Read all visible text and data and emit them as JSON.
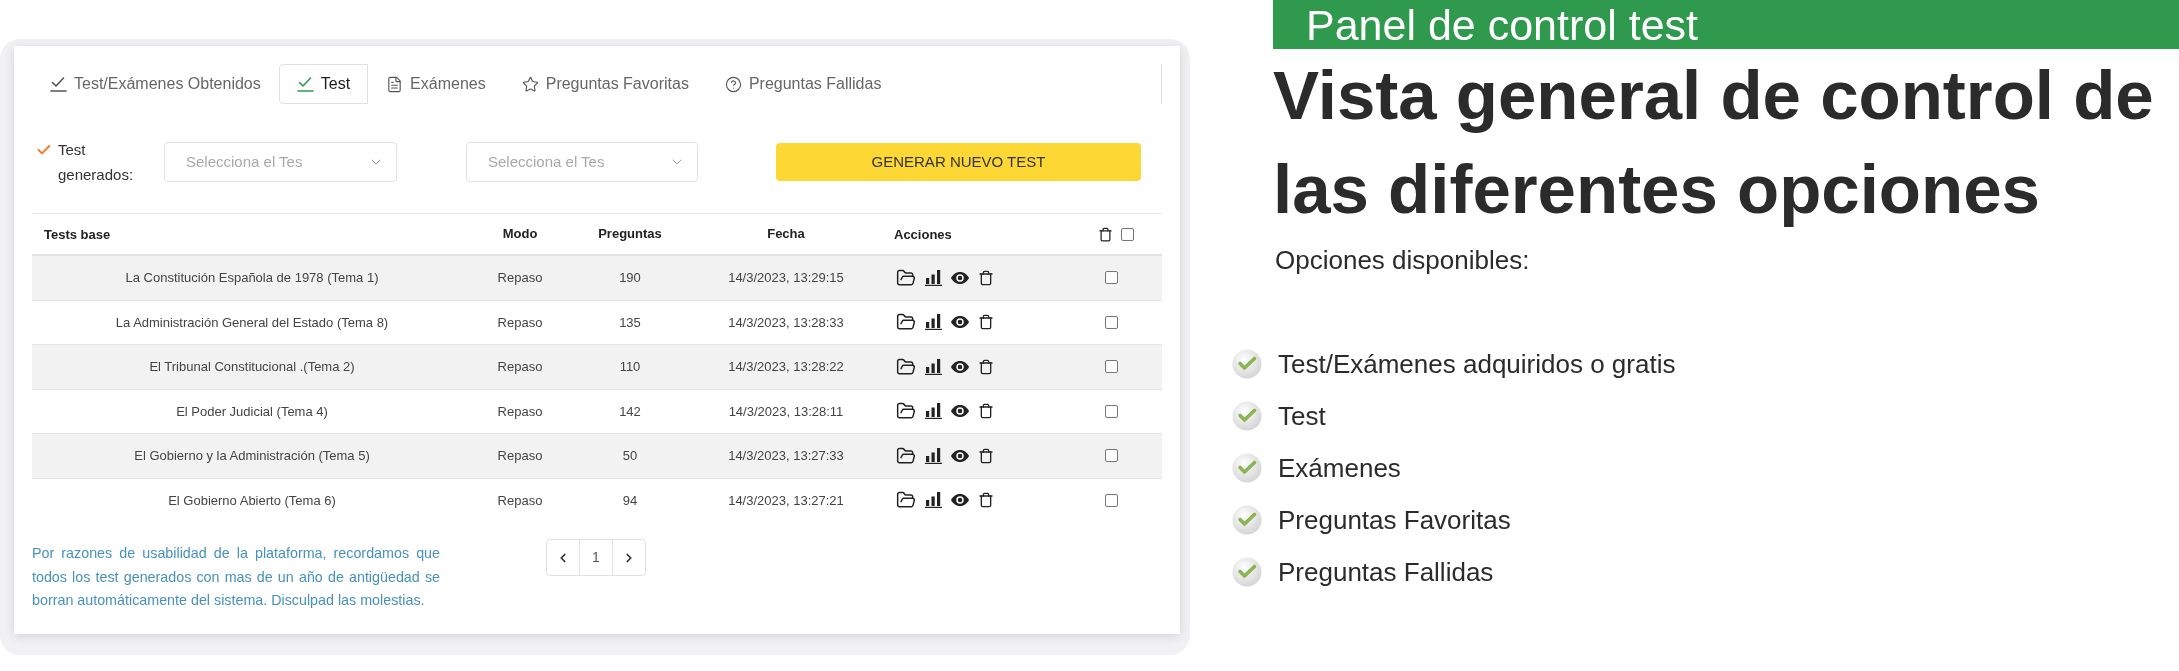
{
  "panel": {
    "tabs": [
      {
        "label": "Test/Exámenes Obtenidos",
        "selected": false
      },
      {
        "label": "Test",
        "selected": true
      },
      {
        "label": "Exámenes",
        "selected": false
      },
      {
        "label": "Preguntas Favoritas",
        "selected": false
      },
      {
        "label": "Preguntas Fallidas",
        "selected": false
      }
    ],
    "filters": {
      "label": "Test generados:",
      "selects": [
        {
          "placeholder": "Selecciona el Tes"
        },
        {
          "placeholder": "Selecciona el Tes"
        }
      ],
      "button": "GENERAR NUEVO TEST"
    },
    "table": {
      "columns": [
        "Tests base",
        "Modo",
        "Preguntas",
        "Fecha",
        "Acciones"
      ],
      "select_all": {
        "checked": false
      },
      "rows": [
        {
          "name": "La Constitución Española de 1978 (Tema 1)",
          "mode": "Repaso",
          "questions": "190",
          "date": "14/3/2023, 13:29:15",
          "checked": false
        },
        {
          "name": "La Administración General del Estado (Tema 8)",
          "mode": "Repaso",
          "questions": "135",
          "date": "14/3/2023, 13:28:33",
          "checked": false
        },
        {
          "name": "El Tribunal Constitucional .(Tema 2)",
          "mode": "Repaso",
          "questions": "110",
          "date": "14/3/2023, 13:28:22",
          "checked": false
        },
        {
          "name": "El Poder Judicial (Tema 4)",
          "mode": "Repaso",
          "questions": "142",
          "date": "14/3/2023, 13:28:11",
          "checked": false
        },
        {
          "name": "El Gobierno y la Administración (Tema 5)",
          "mode": "Repaso",
          "questions": "50",
          "date": "14/3/2023, 13:27:33",
          "checked": false
        },
        {
          "name": "El Gobierno Abierto (Tema 6)",
          "mode": "Repaso",
          "questions": "94",
          "date": "14/3/2023, 13:27:21",
          "checked": false
        }
      ]
    },
    "notice": "Por razones de usabilidad de la plataforma, recordamos que todos los test generados con mas de un año de antigüedad se borran automáticamente del sistema. Disculpad las molestias.",
    "pagination": {
      "page": "1"
    }
  },
  "promo": {
    "banner": "Panel de control test",
    "heading": "Vista general de control de las diferentes opciones",
    "subheading": "Opciones disponibles:",
    "features": [
      "Test/Exámenes adquiridos o gratis",
      "Test",
      "Exámenes",
      "Preguntas Favoritas",
      "Preguntas Fallidas"
    ]
  }
}
